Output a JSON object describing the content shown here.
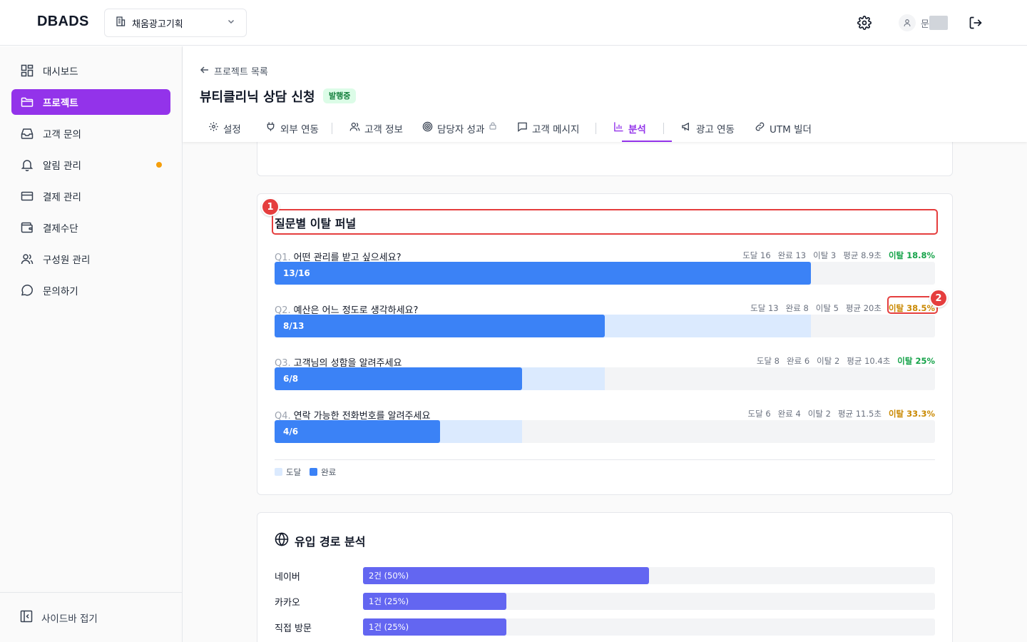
{
  "app": {
    "logo": "DBADS",
    "workspace": "채움광고기획",
    "user_initial": "문"
  },
  "sidebar": {
    "items": [
      {
        "label": "대시보드",
        "icon": "dashboard-icon",
        "active": false
      },
      {
        "label": "프로젝트",
        "icon": "folder-icon",
        "active": true
      },
      {
        "label": "고객 문의",
        "icon": "inbox-icon",
        "active": false
      },
      {
        "label": "알림 관리",
        "icon": "bell-icon",
        "active": false,
        "dot": true
      },
      {
        "label": "결제 관리",
        "icon": "credit-card-icon",
        "active": false
      },
      {
        "label": "결제수단",
        "icon": "wallet-icon",
        "active": false
      },
      {
        "label": "구성원 관리",
        "icon": "users-icon",
        "active": false
      },
      {
        "label": "문의하기",
        "icon": "chat-icon",
        "active": false
      }
    ],
    "collapse_label": "사이드바 접기"
  },
  "header": {
    "back_label": "프로젝트 목록",
    "title": "뷰티클리닉 상담 신청",
    "status_badge": "발행중",
    "tabs": [
      {
        "label": "설정",
        "icon": "gear-icon"
      },
      {
        "label": "외부 연동",
        "icon": "plug-icon"
      },
      {
        "label": "고객 정보",
        "icon": "users-icon"
      },
      {
        "label": "담당자 성과",
        "icon": "target-icon",
        "locked": true
      },
      {
        "label": "고객 메시지",
        "icon": "message-icon"
      },
      {
        "label": "분석",
        "icon": "chart-icon",
        "active": true
      },
      {
        "label": "광고 연동",
        "icon": "megaphone-icon"
      },
      {
        "label": "UTM 빌더",
        "icon": "link-icon"
      }
    ]
  },
  "funnel": {
    "title": "질문별 이탈 퍼널",
    "marker1": "1",
    "marker2": "2",
    "questions": [
      {
        "num": "Q1.",
        "text": "어떤 관리를 받고 싶으세요?",
        "reach": "도달 16",
        "complete": "완료 13",
        "drop": "이탈 3",
        "avg": "평균 8.9초",
        "drop_rate": "이탈 18.8%",
        "bar_label": "13/16",
        "reach_frac": 0.8,
        "done_frac": 0.8125,
        "tone": "green"
      },
      {
        "num": "Q2.",
        "text": "예산은 어느 정도로 생각하세요?",
        "reach": "도달 13",
        "complete": "완료 8",
        "drop": "이탈 5",
        "avg": "평균 20초",
        "drop_rate": "이탈 38.5%",
        "bar_label": "8/13",
        "reach_frac": 0.8125,
        "done_frac": 0.5,
        "tone": "amber"
      },
      {
        "num": "Q3.",
        "text": "고객님의 성함을 알려주세요",
        "reach": "도달 8",
        "complete": "완료 6",
        "drop": "이탈 2",
        "avg": "평균 10.4초",
        "drop_rate": "이탈 25%",
        "bar_label": "6/8",
        "reach_frac": 0.5,
        "done_frac": 0.375,
        "tone": "green"
      },
      {
        "num": "Q4.",
        "text": "연락 가능한 전화번호를 알려주세요",
        "reach": "도달 6",
        "complete": "완료 4",
        "drop": "이탈 2",
        "avg": "평균 11.5초",
        "drop_rate": "이탈 33.3%",
        "bar_label": "4/6",
        "reach_frac": 0.375,
        "done_frac": 0.25,
        "tone": "amber"
      }
    ],
    "legend": {
      "reach": "도달",
      "complete": "완료"
    }
  },
  "sources": {
    "title": "유입 경로 분석",
    "rows": [
      {
        "label": "네이버",
        "value": "2건 (50%)",
        "frac": 0.5
      },
      {
        "label": "카카오",
        "value": "1건 (25%)",
        "frac": 0.25
      },
      {
        "label": "직접 방문",
        "value": "1건 (25%)",
        "frac": 0.25
      }
    ]
  },
  "colors": {
    "accent": "#9333ea",
    "bar_done": "#3b82f6",
    "bar_reach": "#dbeafe",
    "source_bar": "#6366f1",
    "drop_green": "#16a34a",
    "drop_amber": "#ca8a04",
    "highlight": "#e53e3e"
  }
}
